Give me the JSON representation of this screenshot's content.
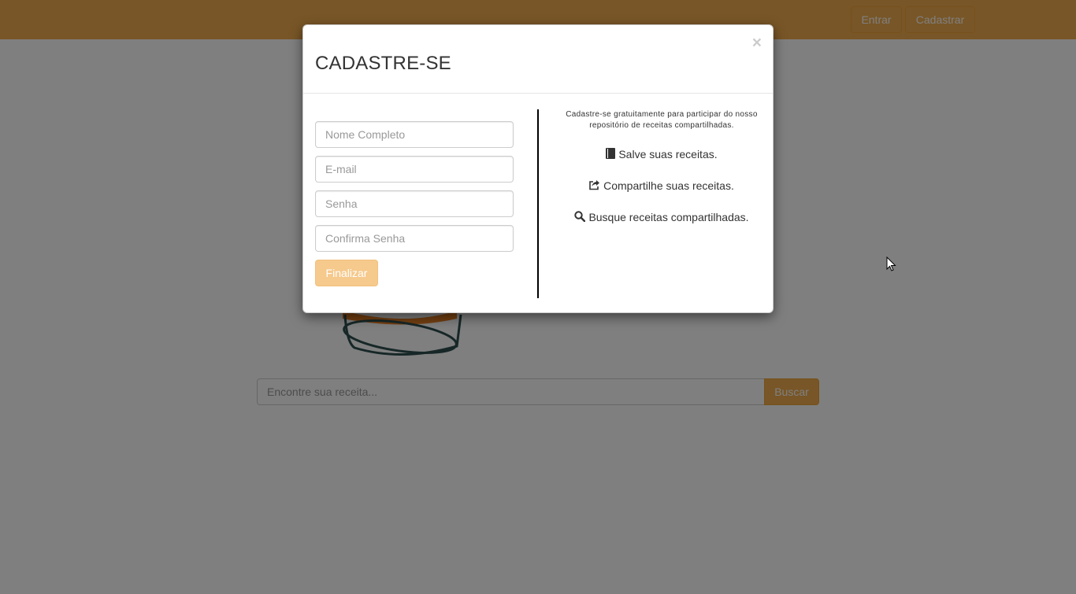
{
  "nav": {
    "entrar_label": "Entrar",
    "cadastrar_label": "Cadastrar"
  },
  "search": {
    "placeholder": "Encontre sua receita...",
    "button_label": "Buscar"
  },
  "modal": {
    "title": "CADASTRE-SE",
    "close_label": "×",
    "fields": {
      "name_placeholder": "Nome Completo",
      "email_placeholder": "E-mail",
      "password_placeholder": "Senha",
      "confirm_placeholder": "Confirma Senha"
    },
    "submit_label": "Finalizar",
    "info_text": "Cadastre-se gratuitamente para participar do nosso repositório de receitas compartilhadas.",
    "features": [
      {
        "icon": "book-icon",
        "label": "Salve suas receitas."
      },
      {
        "icon": "share-icon",
        "label": "Compartilhe suas receitas."
      },
      {
        "icon": "search-icon",
        "label": "Busque receitas compartilhadas."
      }
    ]
  },
  "colors": {
    "accent": "#f0ad4e",
    "accent_disabled": "#f6c98c",
    "backdrop": "rgba(0,0,0,0.5)"
  }
}
